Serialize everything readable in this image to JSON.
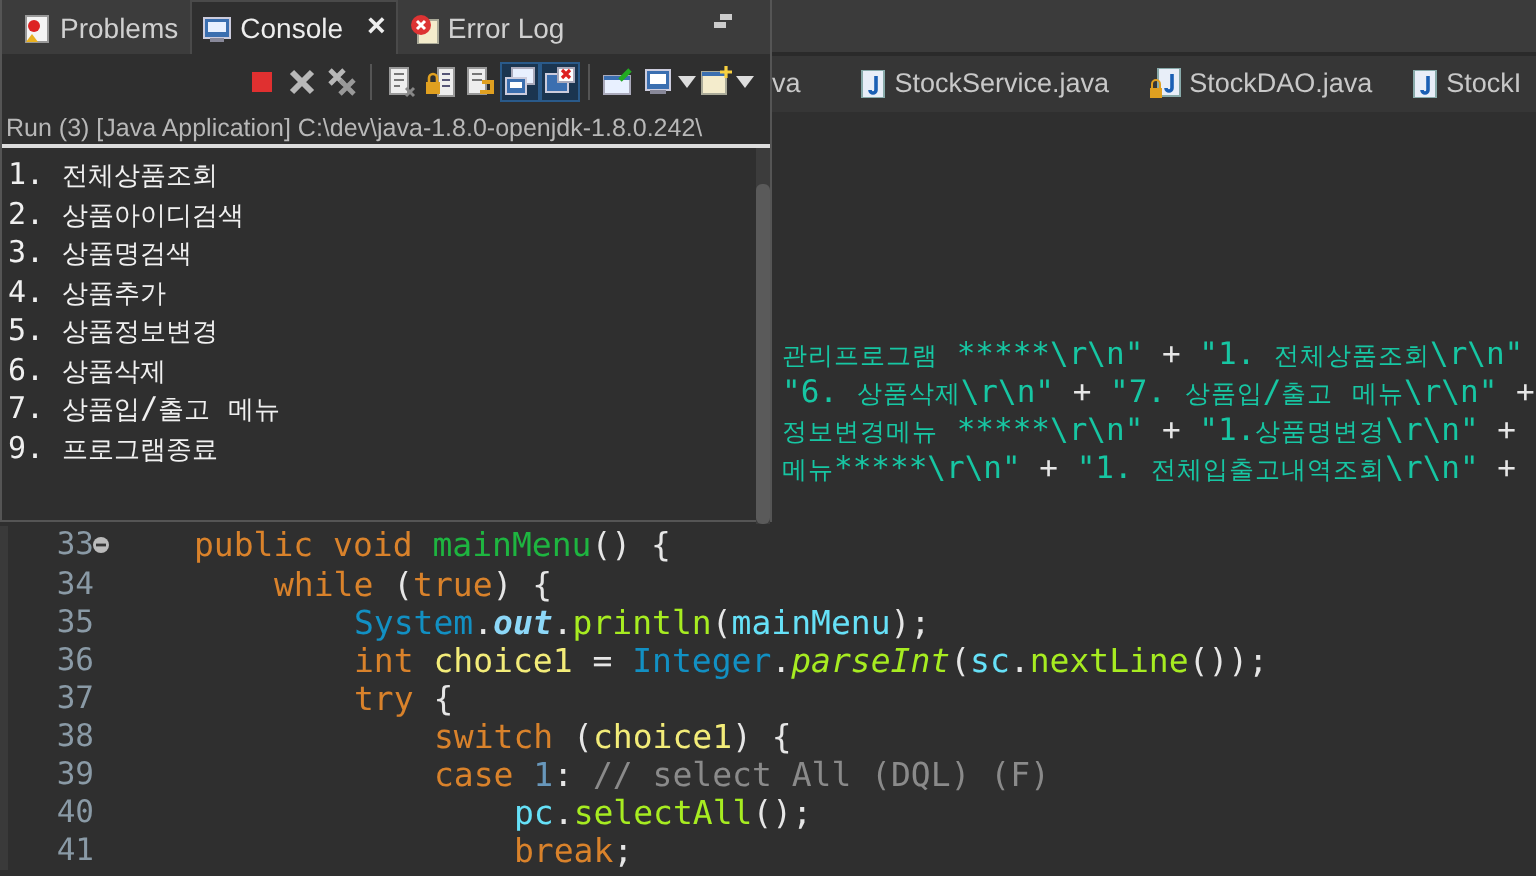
{
  "editor": {
    "tabs": [
      {
        "label": "va",
        "kind": "partial",
        "selected": false
      },
      {
        "label": "StockService.java",
        "kind": "java",
        "selected": false
      },
      {
        "label": "StockDAO.java",
        "kind": "java-locked",
        "selected": false
      },
      {
        "label": "StockI",
        "kind": "java",
        "selected": false
      }
    ],
    "lines": [
      {
        "kind": "covered",
        "segments": [
          {
            "kind": "string",
            "text": "관리프로그램 *****\\r\\n\""
          },
          {
            "kind": "plain",
            "text": " + "
          },
          {
            "kind": "string",
            "text": "\"1. 전체상품조회\\r\\n\""
          }
        ]
      },
      {
        "kind": "covered",
        "segments": [
          {
            "kind": "string",
            "text": "\"6. 상품삭제\\r\\n\""
          },
          {
            "kind": "plain",
            "text": " + "
          },
          {
            "kind": "string",
            "text": "\"7. 상품입/출고 메뉴\\r\\n\""
          },
          {
            "kind": "plain",
            "text": " +"
          }
        ]
      },
      {
        "kind": "covered",
        "segments": [
          {
            "kind": "string",
            "text": "정보변경메뉴 *****\\r\\n\""
          },
          {
            "kind": "plain",
            "text": " + "
          },
          {
            "kind": "string",
            "text": "\"1.상품명변경\\r\\n\""
          },
          {
            "kind": "plain",
            "text": " +"
          }
        ]
      },
      {
        "kind": "covered",
        "segments": [
          {
            "kind": "string",
            "text": "메뉴*****\\r\\n\""
          },
          {
            "kind": "plain",
            "text": " + "
          },
          {
            "kind": "string",
            "text": "\"1. 전체입출고내역조회\\r\\n\""
          },
          {
            "kind": "plain",
            "text": " +"
          }
        ]
      },
      {
        "kind": "covered"
      },
      {
        "kind": "code",
        "number": "33",
        "foldable": true,
        "segments": [
          {
            "kind": "keyword",
            "text": "public void "
          },
          {
            "kind": "declaration",
            "text": "mainMenu"
          },
          {
            "kind": "plain",
            "text": "() {"
          }
        ],
        "children": [
          {
            "kind": "code",
            "number": "34",
            "segments": [
              {
                "kind": "keyword",
                "text": "while"
              },
              {
                "kind": "plain",
                "text": " ("
              },
              {
                "kind": "keyword",
                "text": "true"
              },
              {
                "kind": "plain",
                "text": ") {"
              }
            ],
            "children": [
              {
                "kind": "code",
                "number": "35",
                "segments": [
                  {
                    "kind": "class",
                    "text": "System"
                  },
                  {
                    "kind": "plain",
                    "text": "."
                  },
                  {
                    "kind": "static",
                    "text": "out"
                  },
                  {
                    "kind": "plain",
                    "text": "."
                  },
                  {
                    "kind": "method",
                    "text": "println"
                  },
                  {
                    "kind": "plain",
                    "text": "("
                  },
                  {
                    "kind": "field",
                    "text": "mainMenu"
                  },
                  {
                    "kind": "plain",
                    "text": ");"
                  }
                ]
              },
              {
                "kind": "code",
                "number": "36",
                "segments": [
                  {
                    "kind": "keyword",
                    "text": "int "
                  },
                  {
                    "kind": "variable",
                    "text": "choice1"
                  },
                  {
                    "kind": "plain",
                    "text": " = "
                  },
                  {
                    "kind": "class",
                    "text": "Integer"
                  },
                  {
                    "kind": "plain",
                    "text": "."
                  },
                  {
                    "kind": "static-method",
                    "text": "parseInt"
                  },
                  {
                    "kind": "plain",
                    "text": "("
                  },
                  {
                    "kind": "field",
                    "text": "sc"
                  },
                  {
                    "kind": "plain",
                    "text": "."
                  },
                  {
                    "kind": "method",
                    "text": "nextLine"
                  },
                  {
                    "kind": "plain",
                    "text": "());"
                  }
                ]
              },
              {
                "kind": "code",
                "number": "37",
                "segments": [
                  {
                    "kind": "keyword",
                    "text": "try"
                  },
                  {
                    "kind": "plain",
                    "text": " {"
                  }
                ],
                "children": [
                  {
                    "kind": "code",
                    "number": "38",
                    "segments": [
                      {
                        "kind": "keyword",
                        "text": "switch"
                      },
                      {
                        "kind": "plain",
                        "text": " ("
                      },
                      {
                        "kind": "variable",
                        "text": "choice1"
                      },
                      {
                        "kind": "plain",
                        "text": ") {"
                      }
                    ]
                  },
                  {
                    "kind": "code",
                    "number": "39",
                    "segments": [
                      {
                        "kind": "keyword",
                        "text": "case "
                      },
                      {
                        "kind": "number",
                        "text": "1"
                      },
                      {
                        "kind": "plain",
                        "text": ": "
                      },
                      {
                        "kind": "comment",
                        "text": "// select All (DQL) (F)"
                      }
                    ],
                    "children": [
                      {
                        "kind": "code",
                        "number": "40",
                        "segments": [
                          {
                            "kind": "field",
                            "text": "pc"
                          },
                          {
                            "kind": "plain",
                            "text": "."
                          },
                          {
                            "kind": "method",
                            "text": "selectAll"
                          },
                          {
                            "kind": "plain",
                            "text": "();"
                          }
                        ]
                      },
                      {
                        "kind": "code",
                        "number": "41",
                        "segments": [
                          {
                            "kind": "keyword",
                            "text": "break"
                          },
                          {
                            "kind": "plain",
                            "text": ";"
                          }
                        ]
                      }
                    ]
                  }
                ]
              }
            ]
          }
        ]
      }
    ]
  },
  "console": {
    "tabs": [
      {
        "label": "Problems",
        "kind": "problems",
        "selected": false,
        "closable": false
      },
      {
        "label": "Console",
        "kind": "console",
        "selected": true,
        "closable": true,
        "close": "×"
      },
      {
        "label": "Error Log",
        "kind": "error-log",
        "selected": false,
        "closable": false
      }
    ],
    "toolbar": [
      {
        "kind": "terminate",
        "selected": false
      },
      {
        "kind": "remove",
        "selected": false
      },
      {
        "kind": "remove-all",
        "selected": false
      },
      {
        "kind": "separator"
      },
      {
        "kind": "clear",
        "selected": false
      },
      {
        "kind": "scroll-lock",
        "selected": false
      },
      {
        "kind": "word-wrap",
        "selected": false
      },
      {
        "kind": "show-out",
        "selected": true
      },
      {
        "kind": "show-err",
        "selected": true
      },
      {
        "kind": "separator"
      },
      {
        "kind": "pin",
        "selected": false
      },
      {
        "kind": "display",
        "selected": false
      },
      {
        "kind": "dropdown"
      },
      {
        "kind": "new-console",
        "selected": false
      },
      {
        "kind": "dropdown"
      }
    ],
    "title": "Run (3) [Java Application] C:\\dev\\java-1.8.0-openjdk-1.8.0.242\\",
    "output": [
      "1. 전체상품조회",
      "2. 상품아이디검색",
      "3. 상품명검색",
      "4. 상품추가",
      "5. 상품정보변경",
      "6. 상품삭제",
      "7. 상품입/출고 메뉴",
      "9. 프로그램종료"
    ]
  }
}
